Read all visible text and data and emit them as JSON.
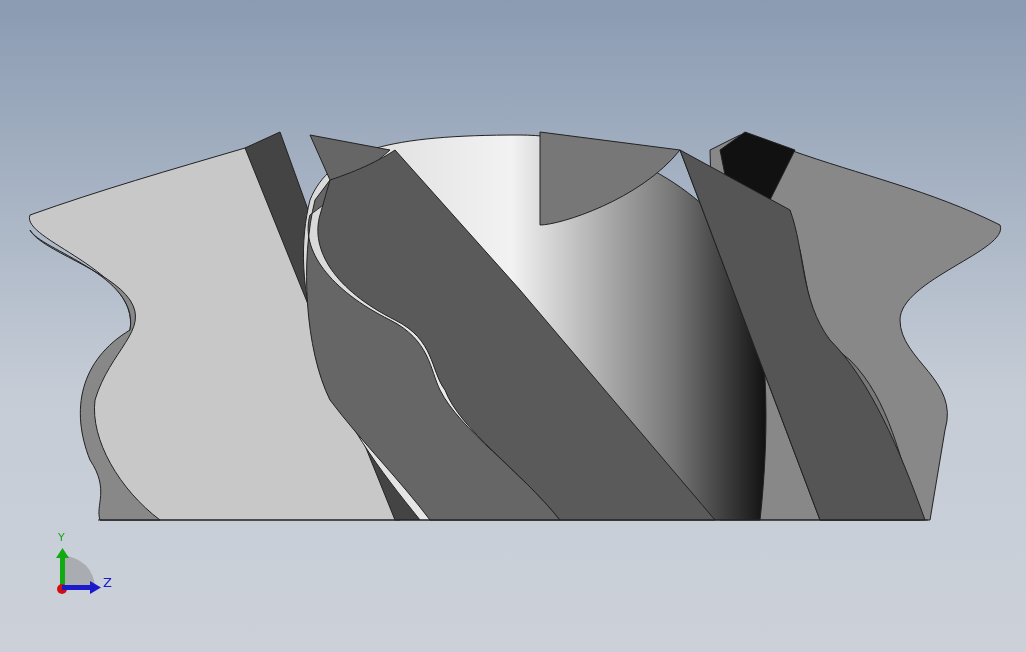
{
  "viewport": {
    "triad": {
      "axes": [
        {
          "kind": "vertical",
          "label": "Y",
          "color": "#11aa11"
        },
        {
          "kind": "horizontal",
          "label": "Z",
          "color": "#1a1acc"
        }
      ]
    }
  }
}
